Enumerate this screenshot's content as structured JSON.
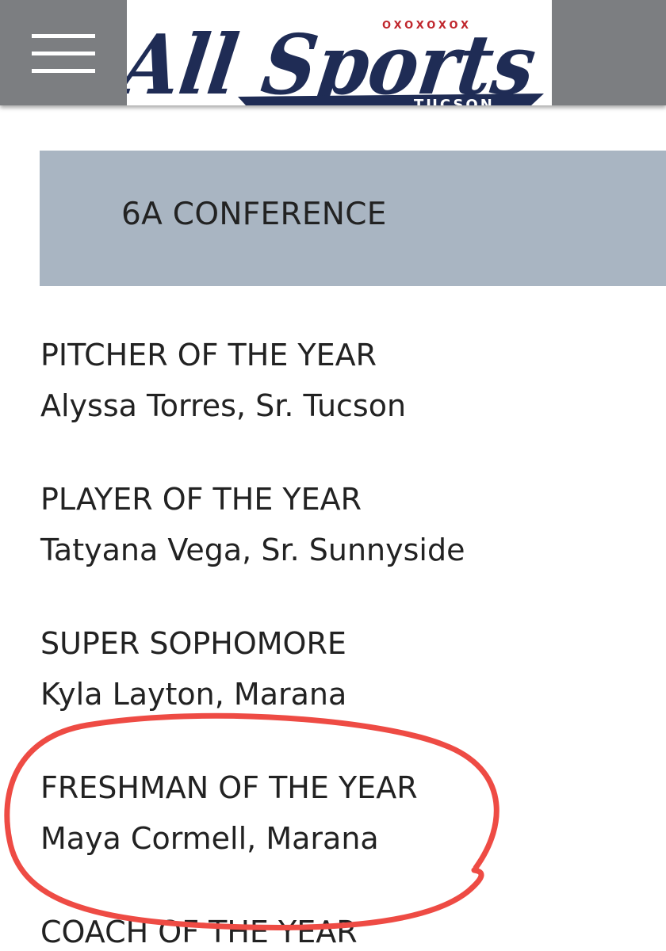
{
  "header": {
    "menu_icon": "hamburger-menu-icon",
    "logo": {
      "brand_text": "All Sports",
      "sub_text": "TUCSON",
      "decor_text": "OXOXOXOX",
      "color": "#1f2c55",
      "accent": "#c0272d"
    }
  },
  "conference": {
    "title": "6A CONFERENCE"
  },
  "awards": [
    {
      "title": "PITCHER OF THE YEAR",
      "winner": "Alyssa Torres, Sr. Tucson"
    },
    {
      "title": "PLAYER OF THE YEAR",
      "winner": "Tatyana Vega, Sr. Sunnyside"
    },
    {
      "title": "SUPER SOPHOMORE",
      "winner": "Kyla Layton, Marana"
    },
    {
      "title": "FRESHMAN OF THE YEAR",
      "winner": "Maya Cormell, Marana"
    },
    {
      "title": "COACH OF THE YEAR",
      "winner": ""
    }
  ],
  "annotation": {
    "color": "#ee4b44"
  }
}
